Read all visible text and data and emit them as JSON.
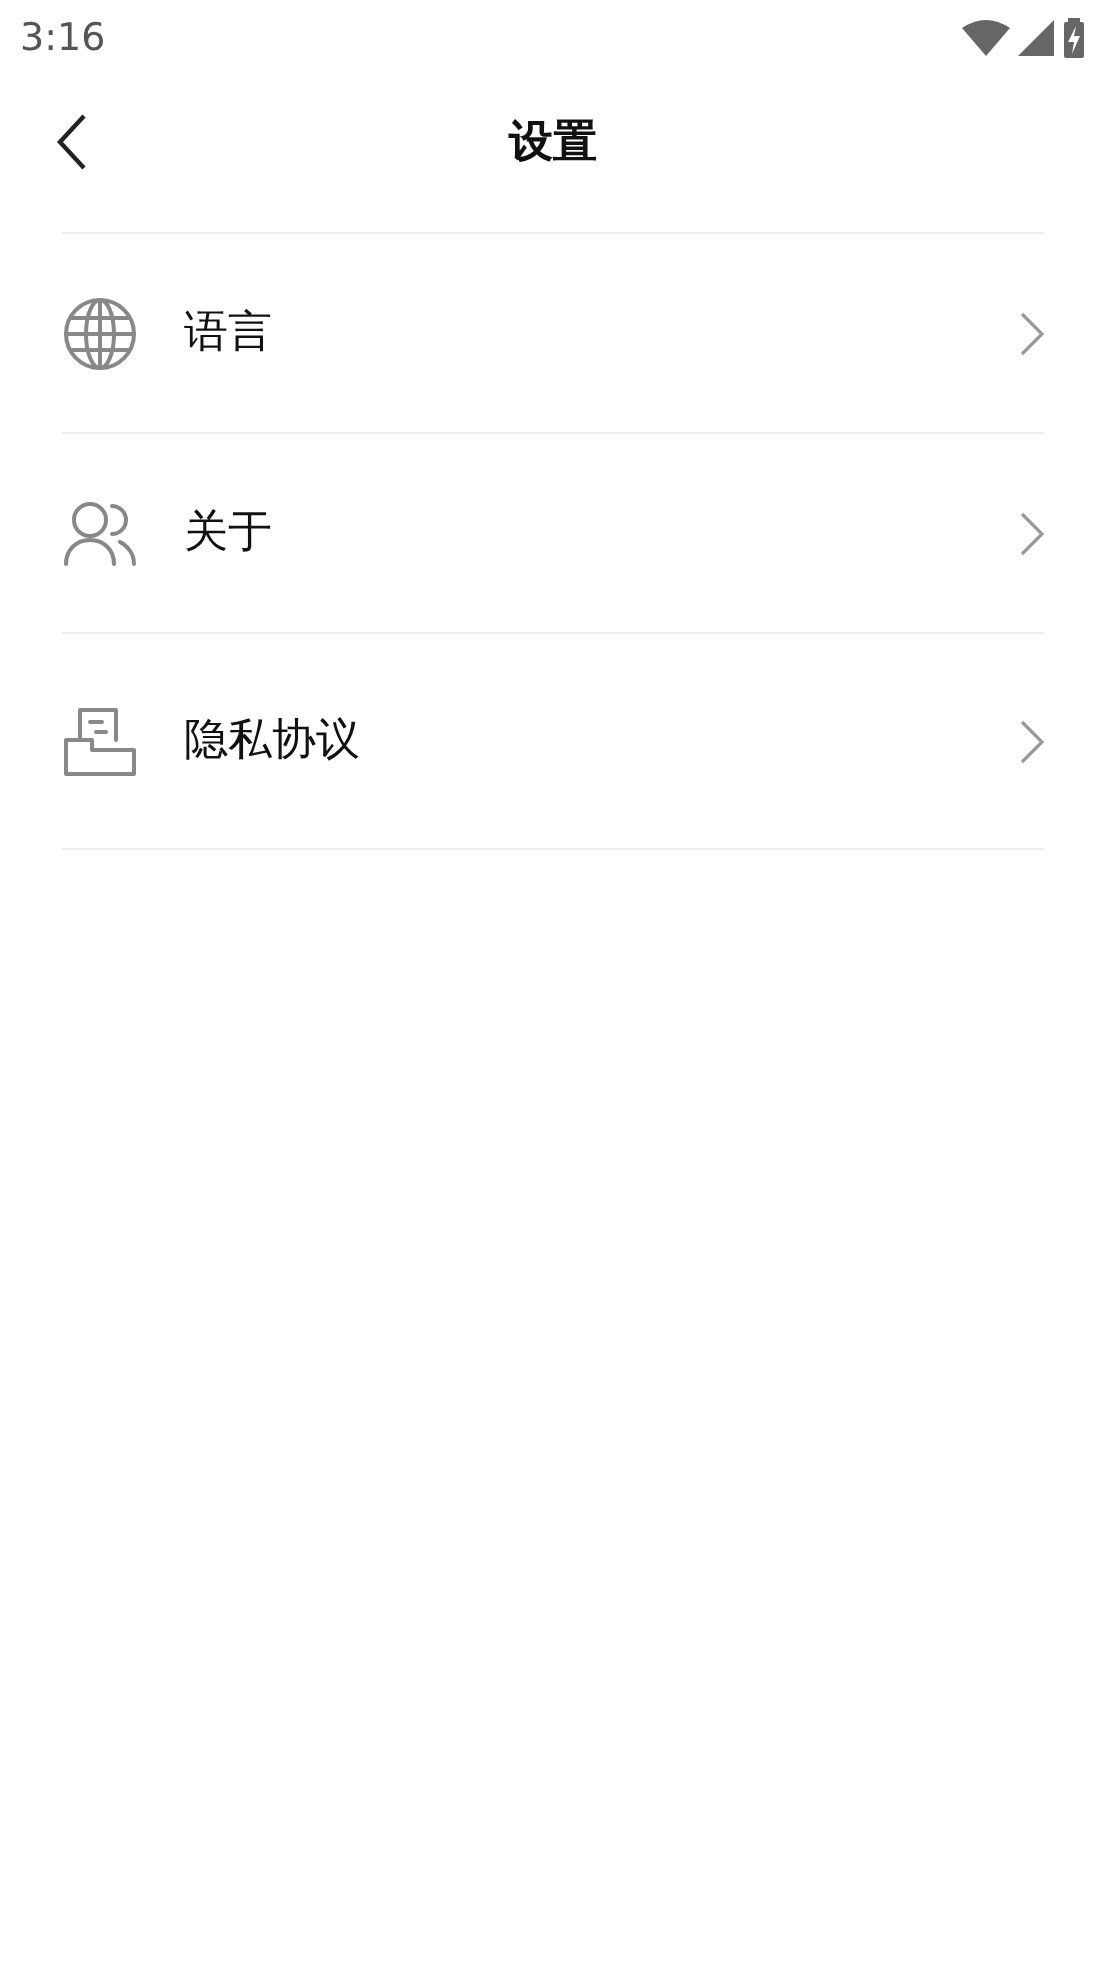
{
  "status_bar": {
    "time": "3:16"
  },
  "header": {
    "title": "设置"
  },
  "items": [
    {
      "kind": "globe",
      "label": "语言"
    },
    {
      "kind": "people",
      "label": "关于"
    },
    {
      "kind": "document",
      "label": "隐私协议"
    }
  ]
}
